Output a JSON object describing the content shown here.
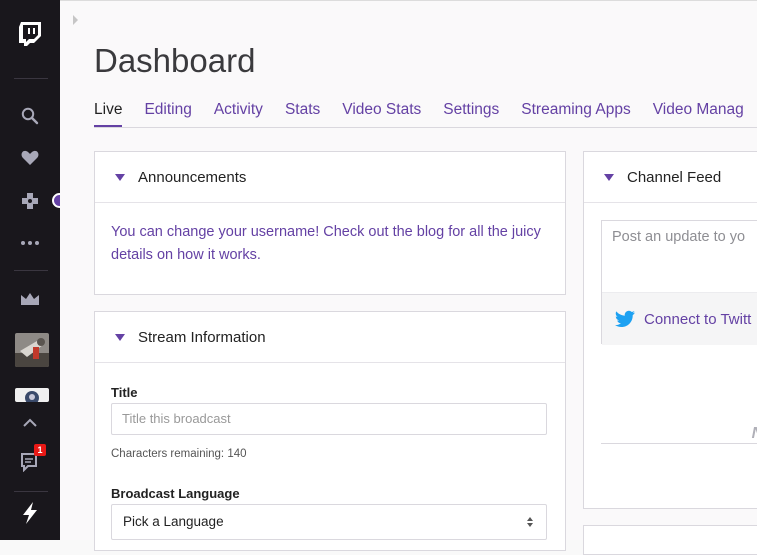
{
  "page": {
    "title": "Dashboard"
  },
  "tabs": [
    {
      "label": "Live",
      "active": true
    },
    {
      "label": "Editing",
      "active": false
    },
    {
      "label": "Activity",
      "active": false
    },
    {
      "label": "Stats",
      "active": false
    },
    {
      "label": "Video Stats",
      "active": false
    },
    {
      "label": "Settings",
      "active": false
    },
    {
      "label": "Streaming Apps",
      "active": false
    },
    {
      "label": "Video Manag",
      "active": false
    }
  ],
  "sidebar": {
    "icons": [
      "twitch-logo-icon",
      "search-icon",
      "heart-icon",
      "gamepad-icon",
      "more-icon",
      "crown-icon"
    ],
    "notification_count": "1"
  },
  "announcements": {
    "title": "Announcements",
    "text": "You can change your username! Check out the blog for all the juicy details on how it works."
  },
  "stream_info": {
    "title": "Stream Information",
    "title_label": "Title",
    "title_placeholder": "Title this broadcast",
    "chars_remaining": "Characters remaining: 140",
    "language_label": "Broadcast Language",
    "language_value": "Pick a Language"
  },
  "channel_feed": {
    "title": "Channel Feed",
    "placeholder": "Post an update to yo",
    "connect_label": "Connect to Twitt",
    "cut_text": "No"
  },
  "colors": {
    "accent": "#6441a4",
    "sidebar": "#19171c",
    "twitter": "#1da1f2"
  }
}
